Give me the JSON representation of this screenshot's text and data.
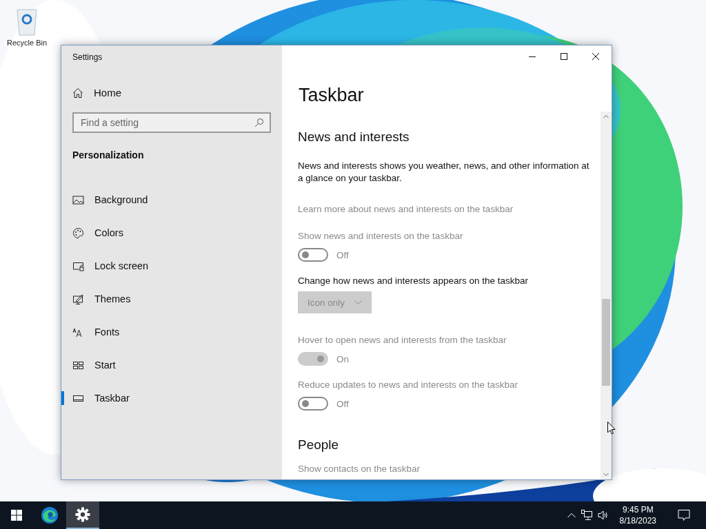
{
  "desktop": {
    "icons": [
      {
        "label": "Recycle Bin"
      }
    ]
  },
  "window": {
    "title": "Settings",
    "sidebar": {
      "home": "Home",
      "search": {
        "placeholder": "Find a setting"
      },
      "group": "Personalization",
      "items": [
        {
          "label": "Background",
          "selected": false
        },
        {
          "label": "Colors",
          "selected": false
        },
        {
          "label": "Lock screen",
          "selected": false
        },
        {
          "label": "Themes",
          "selected": false
        },
        {
          "label": "Fonts",
          "selected": false
        },
        {
          "label": "Start",
          "selected": false
        },
        {
          "label": "Taskbar",
          "selected": true
        }
      ]
    },
    "page": {
      "title": "Taskbar",
      "sections": [
        {
          "heading": "News and interests",
          "settings": [
            {
              "kind": "description",
              "text": "News and interests shows you weather, news, and other information at a glance on your taskbar."
            },
            {
              "kind": "link",
              "text": "Learn more about news and interests on the taskbar",
              "disabled": true
            },
            {
              "kind": "toggle",
              "label": "Show news and interests on the taskbar",
              "on": false,
              "state_text": "Off",
              "disabled": true
            },
            {
              "kind": "dropdown",
              "label": "Change how news and interests appears on the taskbar",
              "value": "Icon only",
              "disabled": true
            },
            {
              "kind": "toggle",
              "label": "Hover to open news and interests from the taskbar",
              "on": true,
              "state_text": "On",
              "disabled": true
            },
            {
              "kind": "toggle",
              "label": "Reduce updates to news and interests on the taskbar",
              "on": false,
              "state_text": "Off",
              "disabled": true
            }
          ]
        },
        {
          "heading": "People",
          "settings": [
            {
              "kind": "label",
              "text": "Show contacts on the taskbar",
              "disabled": true
            }
          ]
        }
      ]
    }
  },
  "taskbar": {
    "apps": [
      {
        "selected": false
      },
      {
        "selected": true
      }
    ],
    "clock": {
      "time": "9:45 PM",
      "date": "8/18/2023"
    }
  }
}
